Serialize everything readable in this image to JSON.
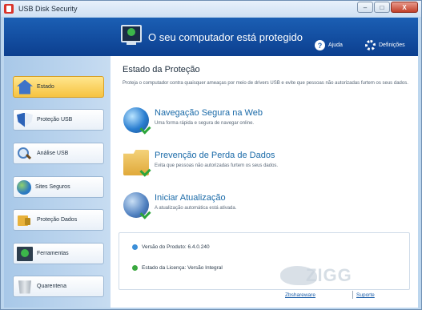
{
  "window": {
    "title": "USB Disk Security",
    "controls": {
      "minimize": "–",
      "maximize": "□",
      "close": "X"
    }
  },
  "header": {
    "status": "O seu computador está protegido",
    "status_icon": "monitor-check-icon",
    "help_label": "Ajuda",
    "settings_label": "Definições"
  },
  "sidebar": {
    "items": [
      {
        "label": "Estado",
        "icon": "home-icon",
        "active": true
      },
      {
        "label": "Proteção USB",
        "icon": "shield-icon",
        "active": false
      },
      {
        "label": "Análise USB",
        "icon": "magnifier-icon",
        "active": false
      },
      {
        "label": "Sites Seguros",
        "icon": "globe-icon",
        "active": false
      },
      {
        "label": "Proteção Dados",
        "icon": "lock-icon",
        "active": false
      },
      {
        "label": "Ferramentas",
        "icon": "tools-icon",
        "active": false
      },
      {
        "label": "Quarentena",
        "icon": "trash-icon",
        "active": false
      }
    ]
  },
  "main": {
    "title": "Estado da Proteção",
    "description": "Proteja o computador contra quaisquer ameaças por meio de drivers USB e evite que pessoas não autorizadas furtem os seus dados.",
    "features": [
      {
        "title": "Navegação Segura na Web",
        "desc": "Uma forma rápida e segura de navegar online.",
        "icon": "globe-icon"
      },
      {
        "title": "Prevenção de Perda de Dados",
        "desc": "Evita que pessoas não autorizadas furtem os seus dados.",
        "icon": "folder-icon"
      },
      {
        "title": "Iniciar Atualização",
        "desc": "A atualização automática está ativada.",
        "icon": "update-globe-icon"
      }
    ],
    "info": {
      "version_label": "Versão do Produto:",
      "version_value": "6.4.0.240",
      "license_label": "Estado da Licença:",
      "license_value": "Versão Integral"
    },
    "watermark": "ZIGG",
    "footer": {
      "link1": "Zbshareware",
      "link2": "Suporte"
    }
  },
  "colors": {
    "header_blue": "#1b5fb4",
    "active_nav": "#f6c340",
    "link_blue": "#1a6aa8",
    "check_green": "#2ca53a"
  }
}
